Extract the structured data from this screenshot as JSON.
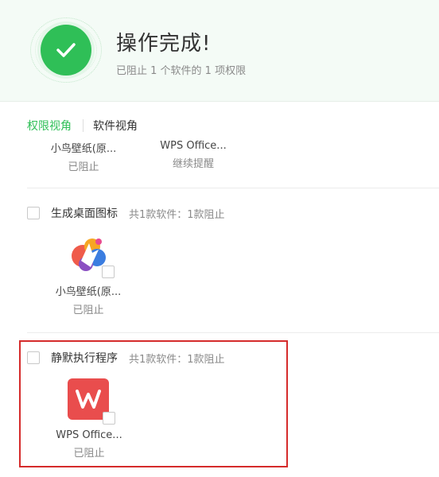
{
  "header": {
    "title": "操作完成!",
    "subtitle": "已阻止 1 个软件的 1 项权限",
    "icon": "check-icon",
    "accent": "#2fbf57"
  },
  "tabs": [
    {
      "label": "权限视角",
      "active": true
    },
    {
      "label": "软件视角",
      "active": false
    }
  ],
  "top_apps": [
    {
      "name": "小鸟壁纸(原...",
      "status": "已阻止"
    },
    {
      "name": "WPS Office...",
      "status": "继续提醒"
    }
  ],
  "sections": [
    {
      "title": "生成桌面图标",
      "meta": "共1款软件：1款阻止",
      "apps": [
        {
          "name": "小鸟壁纸(原...",
          "status": "已阻止",
          "icon": "bird-wallpaper-icon"
        }
      ]
    },
    {
      "title": "静默执行程序",
      "meta": "共1款软件：1款阻止",
      "apps": [
        {
          "name": "WPS Office...",
          "status": "已阻止",
          "icon": "wps-office-icon"
        }
      ]
    }
  ],
  "colors": {
    "highlight": "#d52b2b",
    "wps": "#e94d4d"
  }
}
